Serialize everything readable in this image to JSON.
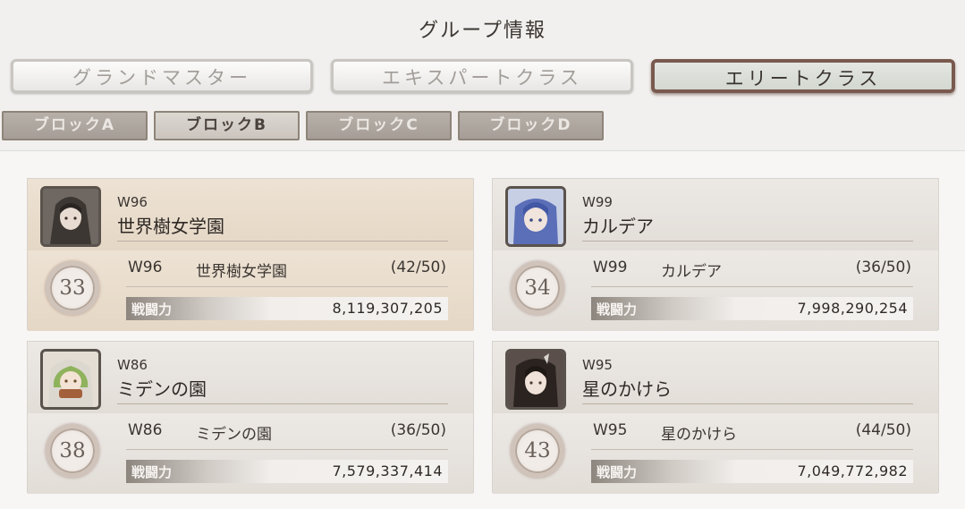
{
  "header": {
    "title": "グループ情報"
  },
  "tabs": [
    {
      "label": "グランドマスター",
      "active": false
    },
    {
      "label": "エキスパートクラス",
      "active": false
    },
    {
      "label": "エリートクラス",
      "active": true
    }
  ],
  "blocks": [
    {
      "label": "ブロックA",
      "active": false
    },
    {
      "label": "ブロックB",
      "active": true
    },
    {
      "label": "ブロックC",
      "active": false
    },
    {
      "label": "ブロックD",
      "active": false
    }
  ],
  "groups": [
    {
      "world": "W96",
      "name": "世界樹女学園",
      "rank": "33",
      "members": "(42/50)",
      "power_label": "戦闘力",
      "power": "8,119,307,205",
      "avatar": "hooded-girl-avatar",
      "highlighted": true
    },
    {
      "world": "W99",
      "name": "カルデア",
      "rank": "34",
      "members": "(36/50)",
      "power_label": "戦闘力",
      "power": "7,998,290,254",
      "avatar": "blue-hair-girl-avatar",
      "highlighted": false
    },
    {
      "world": "W86",
      "name": "ミデンの園",
      "rank": "38",
      "members": "(36/50)",
      "power_label": "戦闘力",
      "power": "7,579,337,414",
      "avatar": "green-hair-girl-avatar",
      "highlighted": false
    },
    {
      "world": "W95",
      "name": "星のかけら",
      "rank": "43",
      "members": "(44/50)",
      "power_label": "戦闘力",
      "power": "7,049,772,982",
      "avatar": "dark-hair-girl-avatar",
      "highlighted": false
    }
  ],
  "colors": {
    "highlight_card": "#e9dccb",
    "active_tab_border": "#7a5a4e"
  }
}
